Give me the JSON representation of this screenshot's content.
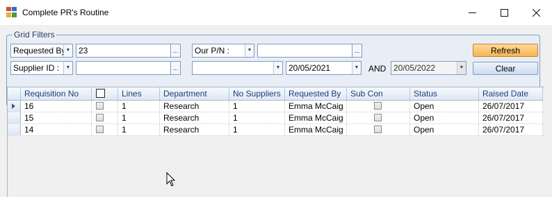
{
  "window": {
    "title": "Complete PR's Routine",
    "controls": {
      "minimize_icon": "minimize-icon",
      "maximize_icon": "maximize-icon",
      "close_icon": "close-icon"
    }
  },
  "filters": {
    "group_label": "Grid Filters",
    "requested_by_combo": "Requested By",
    "requested_by_value": "23",
    "our_pn_combo": "Our P/N :",
    "our_pn_value": "",
    "supplier_id_combo": "Supplier ID :",
    "supplier_id_value": "",
    "unnamed_combo": "",
    "date_from": "20/05/2021",
    "and_label": "AND",
    "date_to": "20/05/2022",
    "ellipsis": "...",
    "refresh_label": "Refresh",
    "clear_label": "Clear"
  },
  "grid": {
    "columns": [
      "Requisition No",
      "",
      "Lines",
      "Department",
      "No Suppliers",
      "Requested By",
      "Sub Con",
      "Status",
      "Raised Date"
    ],
    "rows": [
      {
        "requisition_no": "16",
        "selected": false,
        "lines": "1",
        "department": "Research",
        "no_suppliers": "1",
        "requested_by": "Emma McCaig",
        "sub_con": false,
        "status": "Open",
        "raised_date": "26/07/2017",
        "current": true
      },
      {
        "requisition_no": "15",
        "selected": false,
        "lines": "1",
        "department": "Research",
        "no_suppliers": "1",
        "requested_by": "Emma McCaig",
        "sub_con": false,
        "status": "Open",
        "raised_date": "26/07/2017",
        "current": false
      },
      {
        "requisition_no": "14",
        "selected": false,
        "lines": "1",
        "department": "Research",
        "no_suppliers": "1",
        "requested_by": "Emma McCaig",
        "sub_con": false,
        "status": "Open",
        "raised_date": "26/07/2017",
        "current": false
      }
    ]
  },
  "colors": {
    "accent": "#7b9fc9",
    "header_text": "#1a3e74",
    "refresh_button": "#f7b552"
  }
}
